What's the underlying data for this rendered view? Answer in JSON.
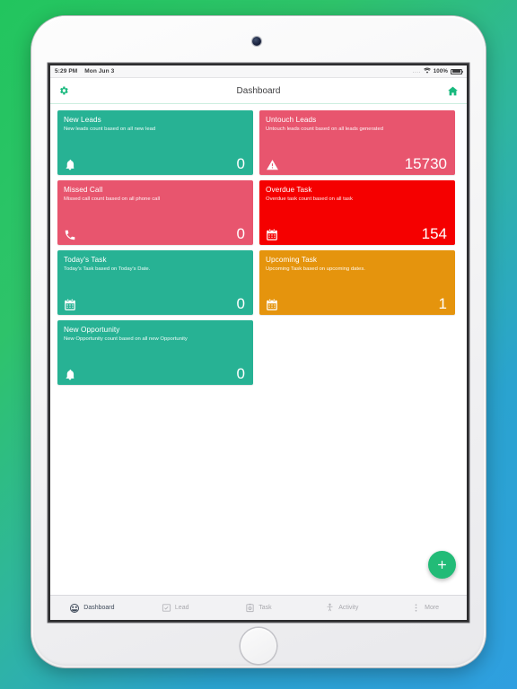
{
  "device": {
    "frame_color": "#f4f4f5",
    "background_gradient": [
      "#22c55e",
      "#2f9fe0"
    ]
  },
  "status_bar": {
    "time": "5:29 PM",
    "date": "Mon Jun 3",
    "dots": "....",
    "wifi_icon": "wifi-icon",
    "battery_percent": "100%"
  },
  "navbar": {
    "title": "Dashboard",
    "left_icon": "gear-icon",
    "right_icon": "home-icon",
    "accent": "#19b97e"
  },
  "cards": [
    {
      "title": "New Leads",
      "subtitle": "New leads count based on all new lead",
      "value": "0",
      "icon": "bell-icon",
      "color": "#27b294"
    },
    {
      "title": "Untouch Leads",
      "subtitle": "Untouch leads count based on all leads generated",
      "value": "15730",
      "icon": "warning-triangle-icon",
      "color": "#e8556e"
    },
    {
      "title": "Missed Call",
      "subtitle": "Missed call count based on all phone call",
      "value": "0",
      "icon": "phone-icon",
      "color": "#e8556e"
    },
    {
      "title": "Overdue Task",
      "subtitle": "Overdue task count based on all task",
      "value": "154",
      "icon": "calendar-icon",
      "color": "#f50000"
    },
    {
      "title": "Today's Task",
      "subtitle": "Today's Task based on Today's Date.",
      "value": "0",
      "icon": "calendar-icon",
      "color": "#27b294"
    },
    {
      "title": "Upcoming Task",
      "subtitle": "Upcoming Task based on upcoming dates.",
      "value": "1",
      "icon": "calendar-icon",
      "color": "#e5940d"
    },
    {
      "title": "New Opportunity",
      "subtitle": "New Opportunity count based on all new Opportunity",
      "value": "0",
      "icon": "bell-icon",
      "color": "#27b294"
    }
  ],
  "fab": {
    "label": "+",
    "icon": "plus-icon",
    "color": "#22bb77"
  },
  "tabbar": {
    "items": [
      {
        "label": "Dashboard",
        "icon": "speedometer-icon",
        "active": true
      },
      {
        "label": "Lead",
        "icon": "lead-card-icon",
        "active": false
      },
      {
        "label": "Task",
        "icon": "clipboard-clock-icon",
        "active": false
      },
      {
        "label": "Activity",
        "icon": "person-icon",
        "active": false
      },
      {
        "label": "More",
        "icon": "more-vertical-icon",
        "active": false
      }
    ]
  }
}
